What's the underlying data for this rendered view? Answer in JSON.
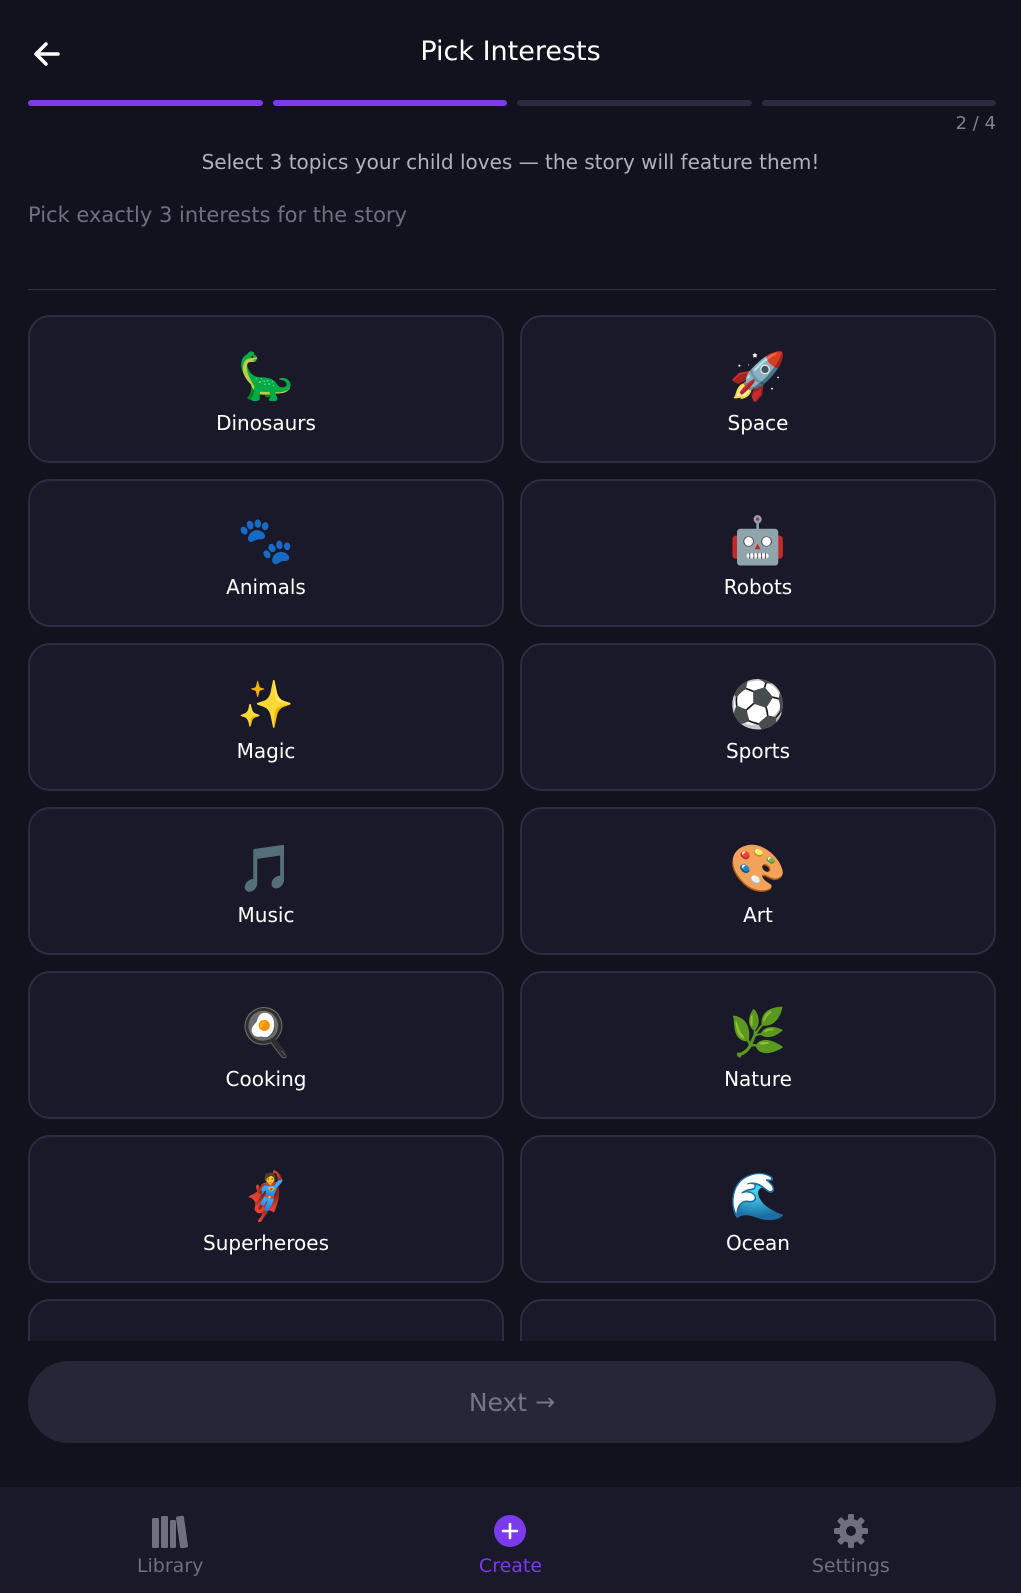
{
  "header": {
    "title": "Pick Interests",
    "back_icon": "arrow-left-icon"
  },
  "progress": {
    "total_steps": 4,
    "current_step": 2,
    "step_label": "2 / 4",
    "accent": "#7c3aed"
  },
  "subtitle": "Select 3 topics your child loves — the story will feature them!",
  "hint": "Pick exactly 3 interests for the story",
  "interests": [
    {
      "emoji": "🦕",
      "label": "Dinosaurs"
    },
    {
      "emoji": "🚀",
      "label": "Space"
    },
    {
      "emoji": "🐾",
      "label": "Animals"
    },
    {
      "emoji": "🤖",
      "label": "Robots"
    },
    {
      "emoji": "✨",
      "label": "Magic"
    },
    {
      "emoji": "⚽",
      "label": "Sports"
    },
    {
      "emoji": "🎵",
      "label": "Music"
    },
    {
      "emoji": "🎨",
      "label": "Art"
    },
    {
      "emoji": "🍳",
      "label": "Cooking"
    },
    {
      "emoji": "🌿",
      "label": "Nature"
    },
    {
      "emoji": "🦸",
      "label": "Superheroes"
    },
    {
      "emoji": "🌊",
      "label": "Ocean"
    }
  ],
  "next_button": {
    "label": "Next",
    "arrow": "→"
  },
  "tabbar": {
    "items": [
      {
        "label": "Library",
        "icon": "library-icon",
        "active": false
      },
      {
        "label": "Create",
        "icon": "plus-circle-icon",
        "active": true
      },
      {
        "label": "Settings",
        "icon": "gear-icon",
        "active": false
      }
    ]
  },
  "colors": {
    "background": "#12121f",
    "card": "#191929",
    "accent": "#7c3aed"
  }
}
